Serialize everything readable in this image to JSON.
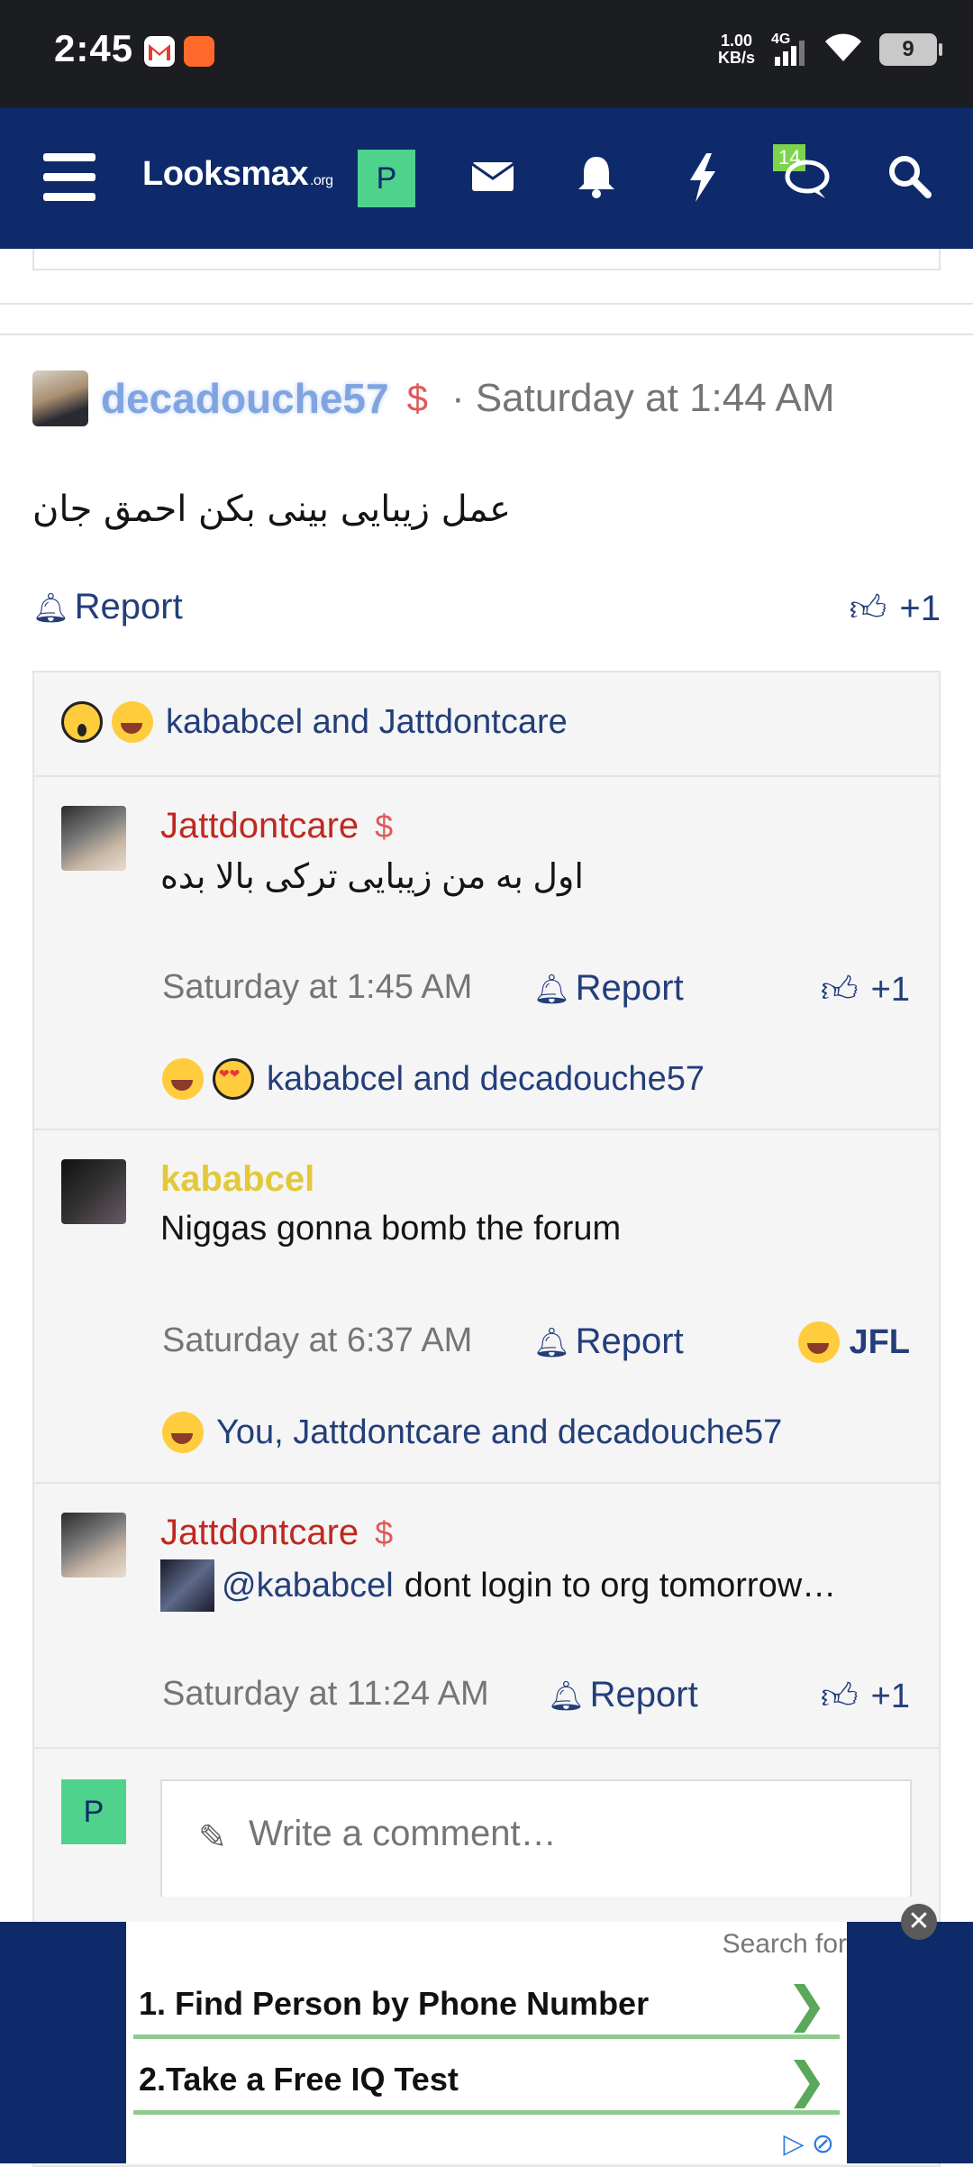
{
  "status_bar": {
    "time": "2:45",
    "net_speed_value": "1.00",
    "net_speed_unit": "KB/s",
    "network": "4G",
    "battery": "9"
  },
  "navbar": {
    "logo_main": "Looksmax",
    "logo_suffix": ".org",
    "user_initial": "P",
    "chat_badge": "14"
  },
  "post": {
    "author": "decadouche57",
    "dollar": "$",
    "separator": "·",
    "time": "Saturday at 1:44 AM",
    "body": "عمل زیبایی بینی بکن احمق جان",
    "report_label": "Report",
    "like_label": "+1",
    "reactions_text": "kababcel and Jattdontcare"
  },
  "comments": [
    {
      "author": "Jattdontcare",
      "author_color": "#c0281f",
      "dollar": "$",
      "text": "اول به من زیبایی ترکی بالا بده",
      "time": "Saturday at 1:45 AM",
      "report_label": "Report",
      "like_label": "+1",
      "reactions_text": "kababcel and decadouche57"
    },
    {
      "author": "kababcel",
      "author_color": "#e2c93a",
      "text": "Niggas gonna bomb the forum",
      "time": "Saturday at 6:37 AM",
      "report_label": "Report",
      "reaction_label": "JFL",
      "reactions_text": "You, Jattdontcare and decadouche57"
    },
    {
      "author": "Jattdontcare",
      "author_color": "#c0281f",
      "dollar": "$",
      "mention": "@kababcel",
      "text": "dont login to org tomorrow…",
      "time": "Saturday at 11:24 AM",
      "report_label": "Report",
      "like_label": "+1"
    }
  ],
  "comment_input": {
    "user_initial": "P",
    "placeholder": "Write a comment…"
  },
  "ad": {
    "search_for": "Search for",
    "items": [
      {
        "label": "1. Find Person by Phone Number"
      },
      {
        "label": "2.Take a Free IQ Test"
      }
    ],
    "close_label": "✕"
  },
  "colors": {
    "nav_bg": "#0e2a6b",
    "link": "#233e7a",
    "accent_green": "#4fd28c"
  }
}
